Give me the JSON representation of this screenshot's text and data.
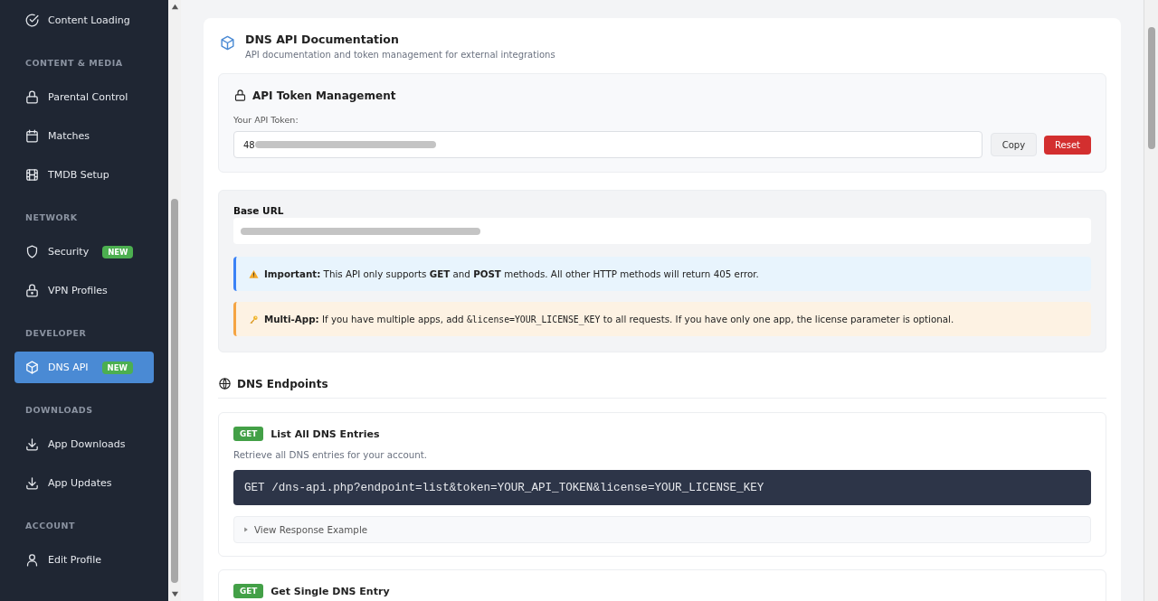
{
  "sidebar": {
    "sections": [
      {
        "items": [
          {
            "label": "Content Loading",
            "selected": false
          }
        ]
      },
      {
        "heading": "CONTENT & MEDIA",
        "items": [
          {
            "label": "Parental Control",
            "selected": false
          },
          {
            "label": "Matches",
            "selected": false
          },
          {
            "label": "TMDB Setup",
            "selected": false
          }
        ]
      },
      {
        "heading": "NETWORK",
        "items": [
          {
            "label": "Security",
            "selected": false,
            "badge": "NEW"
          },
          {
            "label": "VPN Profiles",
            "selected": false
          }
        ]
      },
      {
        "heading": "DEVELOPER",
        "items": [
          {
            "label": "DNS API",
            "selected": true,
            "badge": "NEW"
          }
        ]
      },
      {
        "heading": "DOWNLOADS",
        "items": [
          {
            "label": "App Downloads",
            "selected": false
          },
          {
            "label": "App Updates",
            "selected": false
          }
        ]
      },
      {
        "heading": "ACCOUNT",
        "items": [
          {
            "label": "Edit Profile",
            "selected": false
          }
        ]
      }
    ]
  },
  "page": {
    "title": "DNS API Documentation",
    "subtitle": "API documentation and token management for external integrations"
  },
  "token": {
    "title": "API Token Management",
    "label": "Your API Token:",
    "value": "48",
    "redacted": true,
    "buttons": [
      {
        "label": "Copy",
        "kind": "secondary"
      },
      {
        "label": "Reset",
        "kind": "danger"
      }
    ]
  },
  "base_url": {
    "label": "Base URL",
    "redacted": true
  },
  "notices": [
    {
      "kind": "info",
      "segments": [
        {
          "kind": "text",
          "text": "**Important:** This API only supports **GET** and **POST** methods. All other HTTP methods will return 405 error."
        }
      ]
    },
    {
      "kind": "warning",
      "segments": [
        {
          "kind": "text",
          "text": "**Multi-App:** If you have multiple apps, add "
        },
        {
          "kind": "code",
          "text": "&license=YOUR_LICENSE_KEY"
        },
        {
          "kind": "text",
          "text": " to all requests. If you have only one app, the license parameter is optional."
        }
      ]
    }
  ],
  "endpoints_title": "DNS Endpoints",
  "endpoints": [
    {
      "method": "GET",
      "title": "List All DNS Entries",
      "description": "Retrieve all DNS entries for your account.",
      "request": "GET /dns-api.php?endpoint=list&token=YOUR_API_TOKEN&license=YOUR_LICENSE_KEY",
      "response_toggle": "View Response Example",
      "expanded": false
    },
    {
      "method": "GET",
      "title": "Get Single DNS Entry"
    }
  ]
}
